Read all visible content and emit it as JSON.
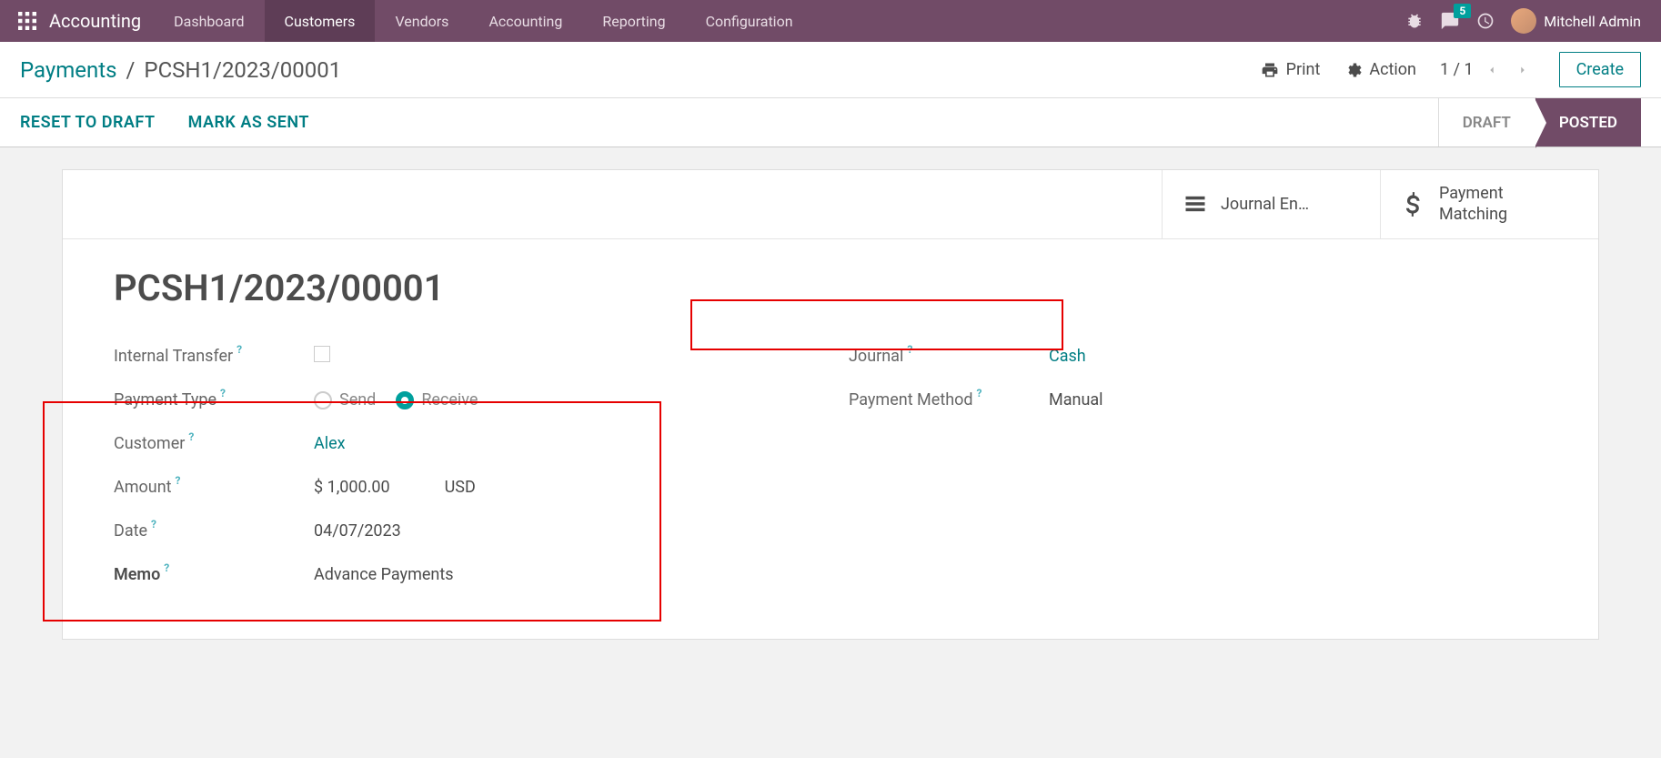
{
  "topnav": {
    "app_name": "Accounting",
    "menu": [
      "Dashboard",
      "Customers",
      "Vendors",
      "Accounting",
      "Reporting",
      "Configuration"
    ],
    "active_menu_index": 1,
    "badge_count": "5",
    "user_name": "Mitchell Admin"
  },
  "ctrlbar": {
    "breadcrumb_link": "Payments",
    "breadcrumb_sep": "/",
    "breadcrumb_current": "PCSH1/2023/00001",
    "print_label": "Print",
    "action_label": "Action",
    "pager_text": "1 / 1",
    "create_label": "Create"
  },
  "statusbar": {
    "reset_label": "RESET TO DRAFT",
    "mark_sent_label": "MARK AS SENT",
    "draft_label": "DRAFT",
    "posted_label": "POSTED"
  },
  "stat_buttons": {
    "journal_entries": "Journal En…",
    "payment_matching_l1": "Payment",
    "payment_matching_l2": "Matching"
  },
  "record": {
    "title": "PCSH1/2023/00001",
    "labels": {
      "internal_transfer": "Internal Transfer",
      "payment_type": "Payment Type",
      "customer": "Customer",
      "amount": "Amount",
      "date": "Date",
      "memo": "Memo",
      "journal": "Journal",
      "payment_method": "Payment Method"
    },
    "payment_type": {
      "send": "Send",
      "receive": "Receive",
      "selected": "receive"
    },
    "customer": "Alex",
    "amount": "$ 1,000.00",
    "currency": "USD",
    "date": "04/07/2023",
    "memo": "Advance Payments",
    "journal": "Cash",
    "payment_method": "Manual",
    "help_mark": "?"
  }
}
